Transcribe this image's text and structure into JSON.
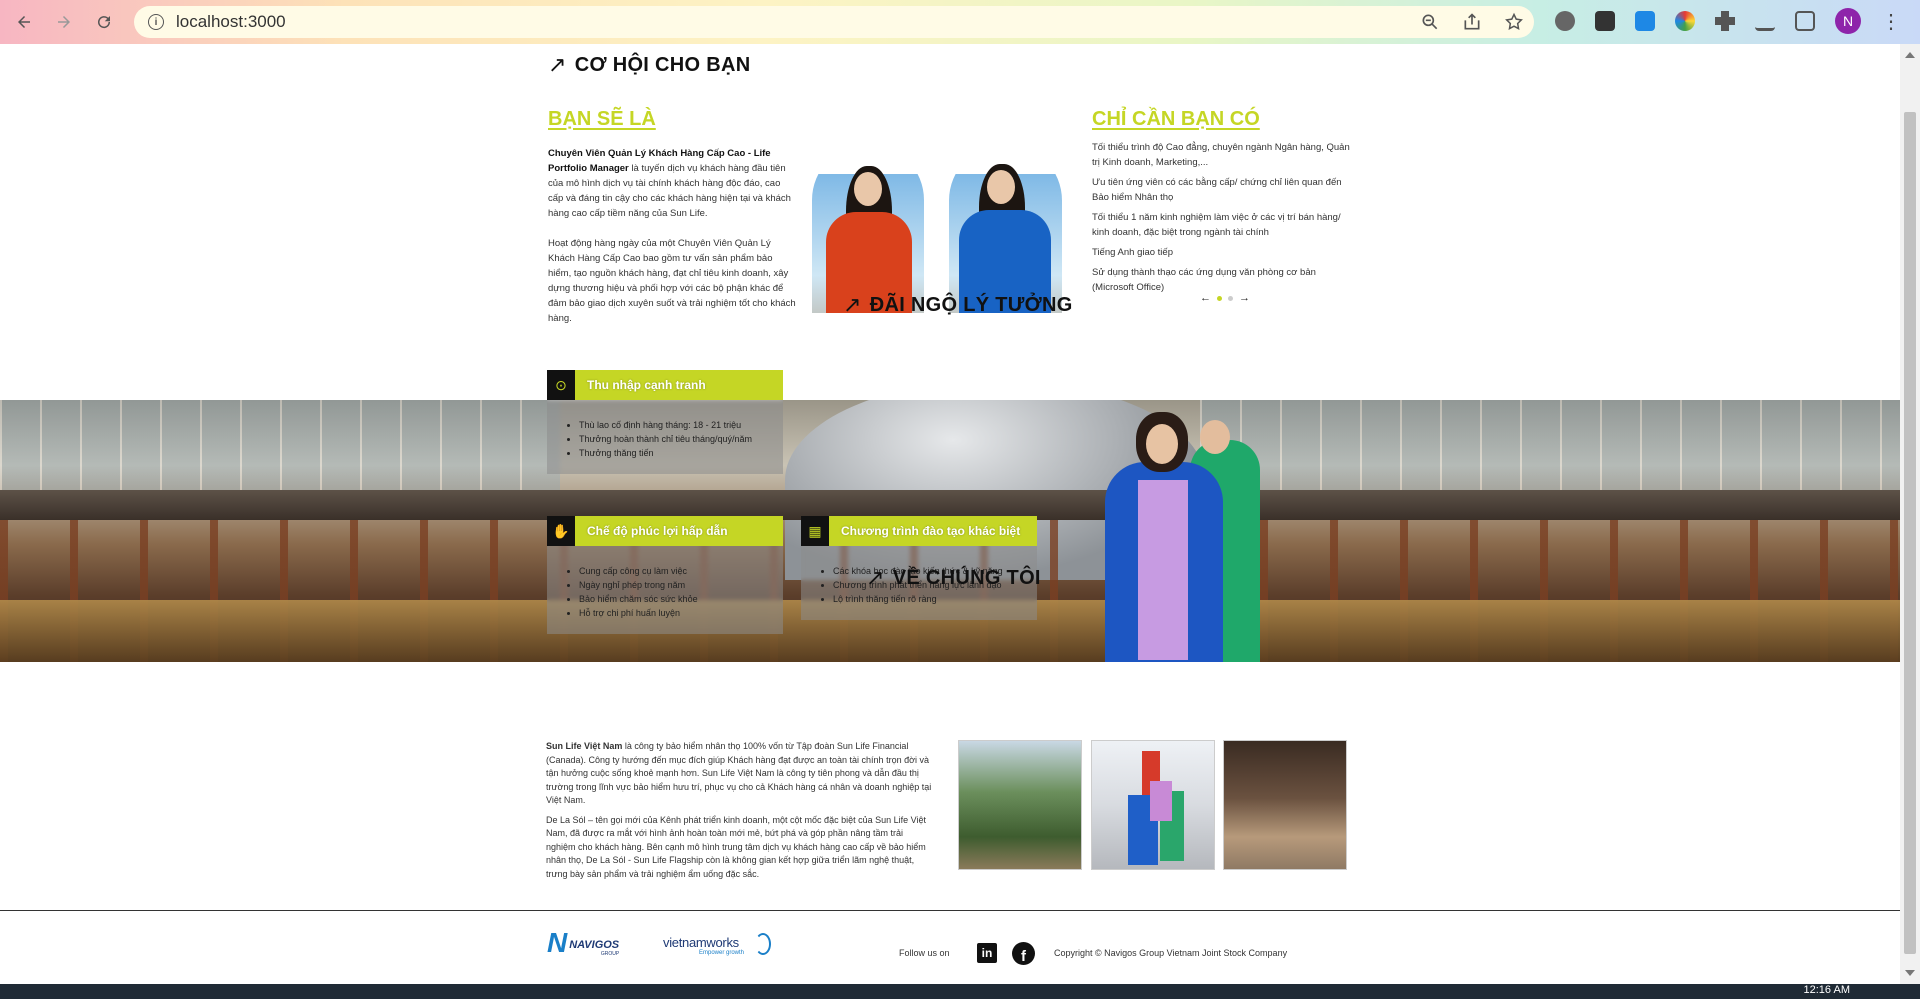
{
  "browser": {
    "url": "localhost:3000",
    "avatar_letter": "N"
  },
  "opportunity": {
    "title": "CƠ HỘI CHO BẠN",
    "you_are_title": "BẠN SẼ LÀ",
    "role_bold": "Chuyên Viên Quản Lý Khách Hàng Cấp Cao - Life Portfolio Manager",
    "role_desc": " là tuyến dịch vụ khách hàng đầu tiên của mô hình dịch vụ tài chính khách hàng độc đáo, cao cấp và đáng tin cậy cho các khách hàng hiện tại và khách hàng cao cấp tiềm năng của Sun Life.",
    "daily_desc": "Hoạt động hàng ngày của một Chuyên Viên Quản Lý Khách Hàng Cấp Cao bao gồm tư vấn sản phẩm bảo hiểm, tạo nguồn khách hàng, đạt chỉ tiêu kinh doanh, xây dựng thương hiệu và phối hợp với các bộ phận khác để đảm bảo giao dịch xuyên suốt và trải nghiệm tốt cho khách hàng.",
    "need_title": "CHỈ CẦN BẠN CÓ",
    "requirements": [
      "Tối thiểu trình độ Cao đẳng, chuyên ngành Ngân hàng, Quản trị Kinh doanh, Marketing,...",
      "Ưu tiên ứng viên có các bằng cấp/ chứng chỉ liên quan đến Bảo hiểm Nhân thọ",
      "Tối thiểu 1 năm kinh nghiệm làm việc ở các vị trí bán hàng/ kinh doanh, đặc biệt trong ngành tài chính",
      "Tiếng Anh giao tiếp",
      "Sử dụng thành thạo các ứng dụng văn phòng cơ bản (Microsoft Office)"
    ],
    "carousel_prev": "←",
    "carousel_next": "→"
  },
  "benefits": {
    "title": "ĐÃI NGỘ LÝ TƯỞNG",
    "cards": [
      {
        "title": "Thu nhập cạnh tranh",
        "icon": "money-icon",
        "items": [
          "Thù lao cố định hàng tháng: 18 - 21 triệu",
          "Thưởng hoàn thành chỉ tiêu tháng/quý/năm",
          "Thưởng thăng tiến"
        ]
      },
      {
        "title": "Chế độ phúc lợi hấp dẫn",
        "icon": "hand-icon",
        "items": [
          "Cung cấp công cụ làm việc",
          "Ngày nghỉ phép trong năm",
          "Bảo hiểm chăm sóc sức khỏe",
          "Hỗ trợ chi phí huấn luyện"
        ]
      },
      {
        "title": "Chương trình đào tạo khác biệt",
        "icon": "training-icon",
        "items": [
          "Các khóa học đào tạo kiến thức & kỹ năng",
          "Chương trình phát triển năng lực lãnh đạo",
          "Lộ trình thăng tiến rõ ràng"
        ]
      }
    ]
  },
  "about": {
    "title": "VỀ CHÚNG TÔI",
    "company_bold": "Sun Life Việt Nam",
    "para1": " là công ty bảo hiểm nhân thọ 100% vốn từ Tập đoàn Sun Life Financial (Canada). Công ty hướng đến mục đích giúp Khách hàng đạt được an toàn tài chính trọn đời và tận hưởng cuộc sống khoẻ mạnh hơn. Sun Life Việt Nam là công ty tiên phong và dẫn đầu thị trường trong lĩnh vực bảo hiểm hưu trí, phục vụ cho cả Khách hàng cá nhân và doanh nghiệp tại Việt Nam.",
    "para2": "De La Sól – tên gọi mới của Kênh phát triển kinh doanh, một cột mốc đặc biệt của Sun Life Việt Nam, đã được ra mắt với hình ảnh hoàn toàn mới mẻ, bứt phá và góp phần nâng tầm trải nghiệm cho khách hàng. Bên cạnh mô hình trung tâm dịch vụ khách hàng cao cấp về bảo hiểm nhân thọ, De La Sól - Sun Life Flagship còn là không gian kết hợp giữa triển lãm nghệ thuật, trưng bày sản phẩm và trải nghiệm ẩm uống đặc sắc."
  },
  "footer": {
    "navigos": "NAVIGOS",
    "navigos_sub": "GROUP",
    "vnw": "vietnamworks",
    "vnw_sub": "Empower growth",
    "follow": "Follow us on",
    "copyright": "Copyright © Navigos Group Vietnam Joint Stock Company"
  },
  "taskbar": {
    "clock": "12:16 AM"
  },
  "colors": {
    "accent": "#c5d625"
  }
}
